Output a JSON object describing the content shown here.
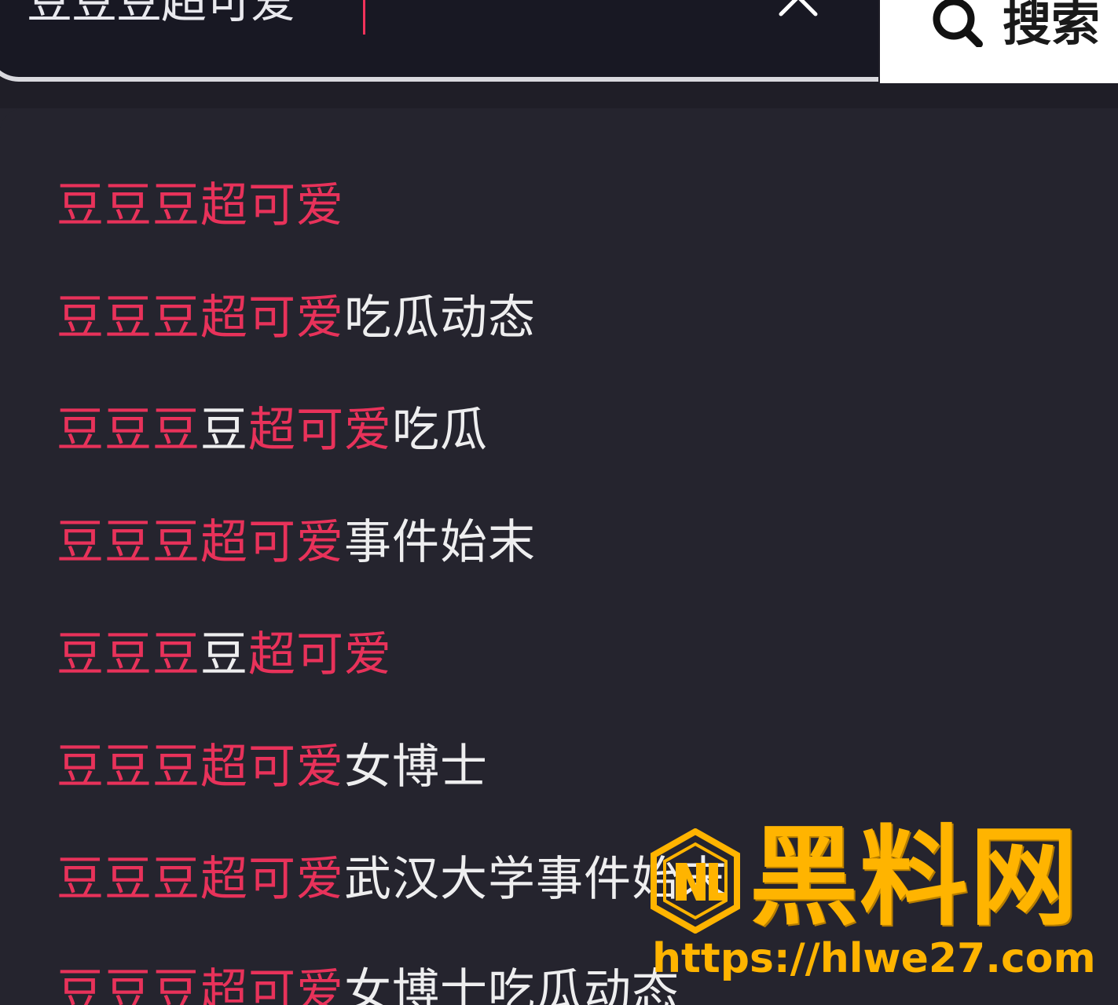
{
  "search": {
    "query": "豆豆豆超可爱",
    "clear_icon": "close-icon",
    "button_icon": "search-icon",
    "button_label": "搜索"
  },
  "suggestions": [
    {
      "segments": [
        {
          "text": "豆豆豆超可爱",
          "highlight": true
        }
      ]
    },
    {
      "segments": [
        {
          "text": "豆豆豆超可爱",
          "highlight": true
        },
        {
          "text": "吃瓜动态",
          "highlight": false
        }
      ]
    },
    {
      "segments": [
        {
          "text": "豆豆豆",
          "highlight": true
        },
        {
          "text": "豆",
          "highlight": false
        },
        {
          "text": "超可爱",
          "highlight": true
        },
        {
          "text": "吃瓜",
          "highlight": false
        }
      ]
    },
    {
      "segments": [
        {
          "text": "豆豆豆超可爱",
          "highlight": true
        },
        {
          "text": "事件始末",
          "highlight": false
        }
      ]
    },
    {
      "segments": [
        {
          "text": "豆豆豆",
          "highlight": true
        },
        {
          "text": "豆",
          "highlight": false
        },
        {
          "text": "超可爱",
          "highlight": true
        }
      ]
    },
    {
      "segments": [
        {
          "text": "豆豆豆超可爱",
          "highlight": true
        },
        {
          "text": "女博士",
          "highlight": false
        }
      ]
    },
    {
      "segments": [
        {
          "text": "豆豆豆超可爱",
          "highlight": true
        },
        {
          "text": "武汉大学事件始末",
          "highlight": false
        }
      ]
    },
    {
      "segments": [
        {
          "text": "豆豆豆超可爱",
          "highlight": true
        },
        {
          "text": "女博士吃瓜动态",
          "highlight": false
        }
      ]
    }
  ],
  "watermark": {
    "title": "黑料网",
    "url": "https://hlwe27.com"
  },
  "colors": {
    "highlight": "#e8325a",
    "text": "#eeeeef",
    "background": "#25242e",
    "watermark": "#ffb400"
  }
}
